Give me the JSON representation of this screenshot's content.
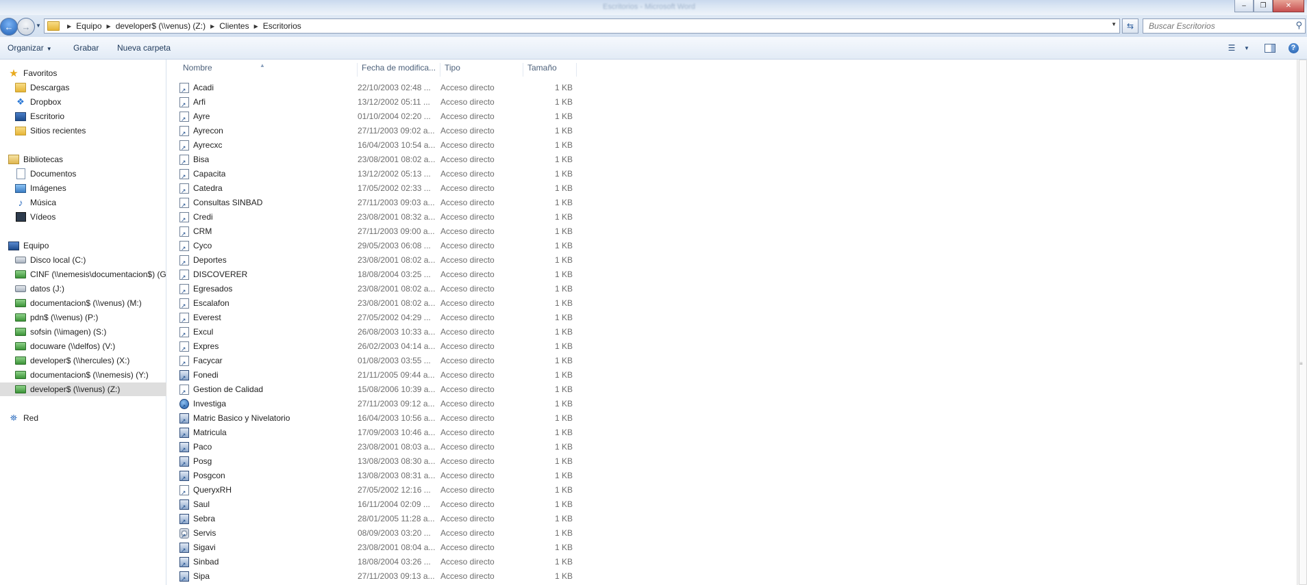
{
  "window": {
    "ghost_title": "Escritorios - Microsoft Word",
    "buttons": [
      "–",
      "❐",
      "✕"
    ]
  },
  "address": {
    "breadcrumbs": [
      "Equipo",
      "developer$ (\\\\venus) (Z:)",
      "Clientes",
      "Escritorios"
    ],
    "search_placeholder": "Buscar Escritorios"
  },
  "toolbar": {
    "organize_label": "Organizar",
    "burn_label": "Grabar",
    "new_folder_label": "Nueva carpeta"
  },
  "sidebar": {
    "favorites": {
      "label": "Favoritos",
      "items": [
        "Descargas",
        "Dropbox",
        "Escritorio",
        "Sitios recientes"
      ]
    },
    "libraries": {
      "label": "Bibliotecas",
      "items": [
        "Documentos",
        "Imágenes",
        "Música",
        "Vídeos"
      ]
    },
    "computer": {
      "label": "Equipo",
      "items": [
        "Disco local (C:)",
        "CINF (\\\\nemesis\\documentacion$) (G:)",
        "datos (J:)",
        "documentacion$ (\\\\venus) (M:)",
        "pdn$ (\\\\venus) (P:)",
        "sofsin (\\\\imagen) (S:)",
        "docuware (\\\\delfos) (V:)",
        "developer$ (\\\\hercules) (X:)",
        "documentacion$ (\\\\nemesis) (Y:)",
        "developer$ (\\\\venus) (Z:)"
      ],
      "selected_index": 9
    },
    "network": {
      "label": "Red"
    }
  },
  "columns": {
    "name": "Nombre",
    "date": "Fecha de modifica...",
    "type": "Tipo",
    "size": "Tamaño"
  },
  "files": [
    {
      "name": "Acadi",
      "date": "22/10/2003 02:48 ...",
      "type": "Acceso directo",
      "size": "1 KB",
      "icon": "shortcut"
    },
    {
      "name": "Arfi",
      "date": "13/12/2002 05:11 ...",
      "type": "Acceso directo",
      "size": "1 KB",
      "icon": "shortcut"
    },
    {
      "name": "Ayre",
      "date": "01/10/2004 02:20 ...",
      "type": "Acceso directo",
      "size": "1 KB",
      "icon": "shortcut"
    },
    {
      "name": "Ayrecon",
      "date": "27/11/2003 09:02 a...",
      "type": "Acceso directo",
      "size": "1 KB",
      "icon": "shortcut"
    },
    {
      "name": "Ayrecxc",
      "date": "16/04/2003 10:54 a...",
      "type": "Acceso directo",
      "size": "1 KB",
      "icon": "shortcut"
    },
    {
      "name": "Bisa",
      "date": "23/08/2001 08:02 a...",
      "type": "Acceso directo",
      "size": "1 KB",
      "icon": "shortcut"
    },
    {
      "name": "Capacita",
      "date": "13/12/2002 05:13 ...",
      "type": "Acceso directo",
      "size": "1 KB",
      "icon": "shortcut"
    },
    {
      "name": "Catedra",
      "date": "17/05/2002 02:33 ...",
      "type": "Acceso directo",
      "size": "1 KB",
      "icon": "shortcut"
    },
    {
      "name": "Consultas SINBAD",
      "date": "27/11/2003 09:03 a...",
      "type": "Acceso directo",
      "size": "1 KB",
      "icon": "shortcut"
    },
    {
      "name": "Credi",
      "date": "23/08/2001 08:32 a...",
      "type": "Acceso directo",
      "size": "1 KB",
      "icon": "shortcut"
    },
    {
      "name": "CRM",
      "date": "27/11/2003 09:00 a...",
      "type": "Acceso directo",
      "size": "1 KB",
      "icon": "shortcut"
    },
    {
      "name": "Cyco",
      "date": "29/05/2003 06:08 ...",
      "type": "Acceso directo",
      "size": "1 KB",
      "icon": "shortcut"
    },
    {
      "name": "Deportes",
      "date": "23/08/2001 08:02 a...",
      "type": "Acceso directo",
      "size": "1 KB",
      "icon": "shortcut"
    },
    {
      "name": "DISCOVERER",
      "date": "18/08/2004 03:25 ...",
      "type": "Acceso directo",
      "size": "1 KB",
      "icon": "shortcut"
    },
    {
      "name": "Egresados",
      "date": "23/08/2001 08:02 a...",
      "type": "Acceso directo",
      "size": "1 KB",
      "icon": "shortcut"
    },
    {
      "name": "Escalafon",
      "date": "23/08/2001 08:02 a...",
      "type": "Acceso directo",
      "size": "1 KB",
      "icon": "shortcut"
    },
    {
      "name": "Everest",
      "date": "27/05/2002 04:29 ...",
      "type": "Acceso directo",
      "size": "1 KB",
      "icon": "shortcut"
    },
    {
      "name": "Excul",
      "date": "26/08/2003 10:33 a...",
      "type": "Acceso directo",
      "size": "1 KB",
      "icon": "shortcut"
    },
    {
      "name": "Expres",
      "date": "26/02/2003 04:14 a...",
      "type": "Acceso directo",
      "size": "1 KB",
      "icon": "shortcut"
    },
    {
      "name": "Facycar",
      "date": "01/08/2003 03:55 ...",
      "type": "Acceso directo",
      "size": "1 KB",
      "icon": "shortcut"
    },
    {
      "name": "Fonedi",
      "date": "21/11/2005 09:44 a...",
      "type": "Acceso directo",
      "size": "1 KB",
      "icon": "app"
    },
    {
      "name": "Gestion de Calidad",
      "date": "15/08/2006 10:39 a...",
      "type": "Acceso directo",
      "size": "1 KB",
      "icon": "shortcut"
    },
    {
      "name": "Investiga",
      "date": "27/11/2003 09:12 a...",
      "type": "Acceso directo",
      "size": "1 KB",
      "icon": "globe"
    },
    {
      "name": "Matric Basico y Nivelatorio",
      "date": "16/04/2003 10:56 a...",
      "type": "Acceso directo",
      "size": "1 KB",
      "icon": "app"
    },
    {
      "name": "Matricula",
      "date": "17/09/2003 10:46 a...",
      "type": "Acceso directo",
      "size": "1 KB",
      "icon": "app"
    },
    {
      "name": "Paco",
      "date": "23/08/2001 08:03 a...",
      "type": "Acceso directo",
      "size": "1 KB",
      "icon": "app"
    },
    {
      "name": "Posg",
      "date": "13/08/2003 08:30 a...",
      "type": "Acceso directo",
      "size": "1 KB",
      "icon": "app"
    },
    {
      "name": "Posgcon",
      "date": "13/08/2003 08:31 a...",
      "type": "Acceso directo",
      "size": "1 KB",
      "icon": "app"
    },
    {
      "name": "QueryxRH",
      "date": "27/05/2002 12:16 ...",
      "type": "Acceso directo",
      "size": "1 KB",
      "icon": "shortcut"
    },
    {
      "name": "Saul",
      "date": "16/11/2004 02:09 ...",
      "type": "Acceso directo",
      "size": "1 KB",
      "icon": "app"
    },
    {
      "name": "Sebra",
      "date": "28/01/2005 11:28 a...",
      "type": "Acceso directo",
      "size": "1 KB",
      "icon": "app"
    },
    {
      "name": "Servis",
      "date": "08/09/2003 03:20 ...",
      "type": "Acceso directo",
      "size": "1 KB",
      "icon": "gear"
    },
    {
      "name": "Sigavi",
      "date": "23/08/2001 08:04 a...",
      "type": "Acceso directo",
      "size": "1 KB",
      "icon": "app"
    },
    {
      "name": "Sinbad",
      "date": "18/08/2004 03:26 ...",
      "type": "Acceso directo",
      "size": "1 KB",
      "icon": "app"
    },
    {
      "name": "Sipa",
      "date": "27/11/2003 09:13 a...",
      "type": "Acceso directo",
      "size": "1 KB",
      "icon": "app"
    }
  ],
  "colors": {
    "selection": "#dedede",
    "header_text": "#4c607a",
    "meta_text": "#6d6d6d"
  }
}
